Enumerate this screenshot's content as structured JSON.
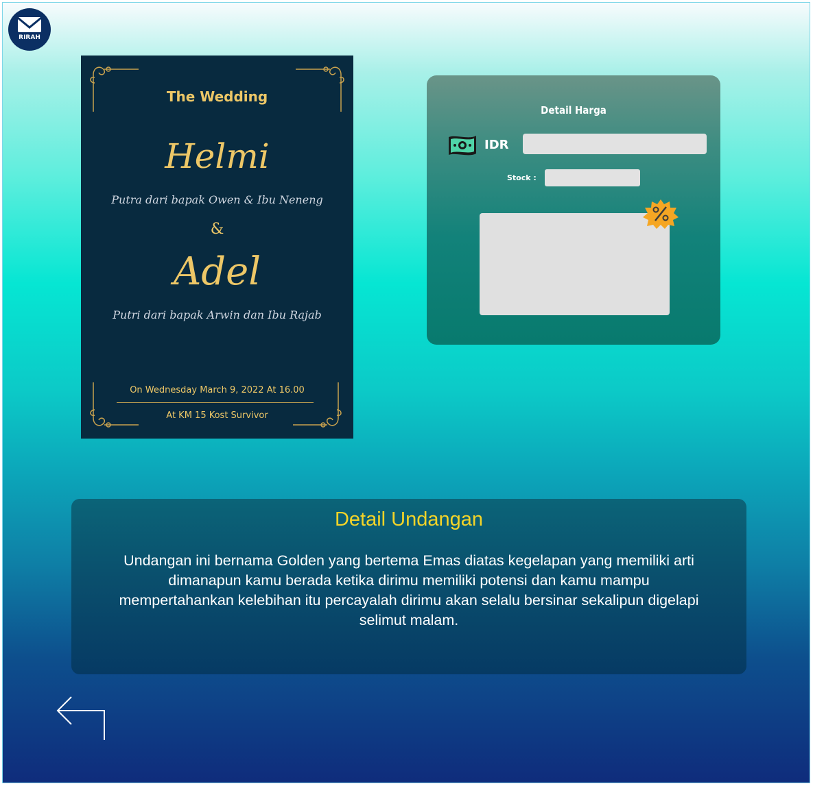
{
  "logo": {
    "text": "RIRAH"
  },
  "invitation": {
    "title": "The Wedding",
    "groom": "Helmi",
    "groom_parents": "Putra dari bapak Owen & Ibu Neneng",
    "ampersand": "&",
    "bride": "Adel",
    "bride_parents": "Putri dari bapak Arwin dan Ibu Rajab",
    "date": "On Wednesday March 9, 2022 At 16.00",
    "place": "At KM 15 Kost Survivor"
  },
  "price_panel": {
    "title": "Detail Harga",
    "currency_label": "IDR",
    "price_value": "",
    "stock_label": "Stock :",
    "stock_value": "",
    "discount_value": ""
  },
  "detail": {
    "title": "Detail Undangan",
    "description": "Undangan ini bernama Golden yang bertema Emas diatas kegelapan yang memiliki arti dimanapun kamu berada ketika dirimu memiliki potensi dan kamu mampu mempertahankan kelebihan itu percayalah dirimu akan selalu bersinar sekalipun digelapi selimut malam."
  },
  "icons": {
    "logo": "envelope-icon",
    "money": "money-icon",
    "discount": "discount-badge-icon",
    "back": "back-arrow-icon"
  },
  "colors": {
    "gold": "#edc767",
    "card_bg": "#082a3f",
    "title_yellow": "#f4d428"
  }
}
